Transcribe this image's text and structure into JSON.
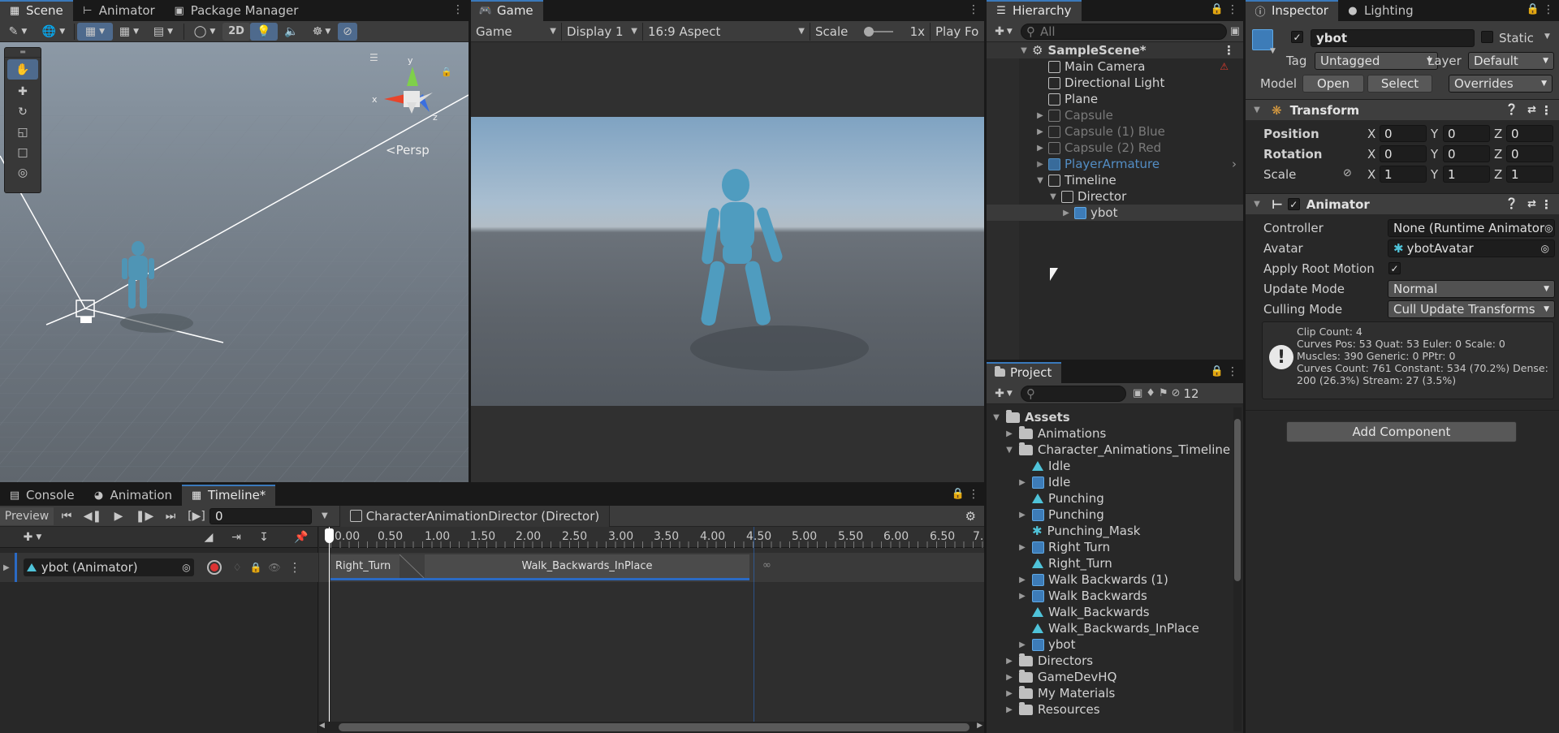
{
  "scene_panel": {
    "tabs": [
      {
        "label": "Scene"
      },
      {
        "label": "Animator"
      },
      {
        "label": "Package Manager"
      }
    ],
    "toolbar": {
      "mode_2d": "2D"
    },
    "gizmo": {
      "persp": "<Persp",
      "axis_x": "x",
      "axis_y": "y",
      "axis_z": "z"
    }
  },
  "game_panel": {
    "tab": "Game",
    "toolbar": {
      "view": "Game",
      "display": "Display 1",
      "aspect": "16:9 Aspect",
      "scale_label": "Scale",
      "scale_value": "1x",
      "play_focused": "Play Fo"
    }
  },
  "hierarchy": {
    "tab": "Hierarchy",
    "search_placeholder": "All",
    "scene_name": "SampleScene*",
    "items": [
      {
        "label": "Main Camera"
      },
      {
        "label": "Directional Light"
      },
      {
        "label": "Plane"
      },
      {
        "label": "Capsule"
      },
      {
        "label": "Capsule (1) Blue"
      },
      {
        "label": "Capsule (2) Red"
      },
      {
        "label": "PlayerArmature"
      },
      {
        "label": "Timeline"
      },
      {
        "label": "Director"
      },
      {
        "label": "ybot"
      }
    ]
  },
  "project": {
    "tab": "Project",
    "hidden_count": "12",
    "root": "Assets",
    "items": [
      {
        "label": "Animations"
      },
      {
        "label": "Character_Animations_Timeline"
      },
      {
        "label": "Idle"
      },
      {
        "label": "Idle"
      },
      {
        "label": "Punching"
      },
      {
        "label": "Punching"
      },
      {
        "label": "Punching_Mask"
      },
      {
        "label": "Right Turn"
      },
      {
        "label": "Right_Turn"
      },
      {
        "label": "Walk Backwards (1)"
      },
      {
        "label": "Walk Backwards"
      },
      {
        "label": "Walk_Backwards"
      },
      {
        "label": "Walk_Backwards_InPlace"
      },
      {
        "label": "ybot"
      },
      {
        "label": "Directors"
      },
      {
        "label": "GameDevHQ"
      },
      {
        "label": "My Materials"
      },
      {
        "label": "Resources"
      }
    ]
  },
  "inspector": {
    "tabs": [
      {
        "label": "Inspector"
      },
      {
        "label": "Lighting"
      }
    ],
    "object_name": "ybot",
    "static_label": "Static",
    "tag_label": "Tag",
    "tag_value": "Untagged",
    "layer_label": "Layer",
    "layer_value": "Default",
    "model_label": "Model",
    "open_label": "Open",
    "select_label": "Select",
    "overrides_label": "Overrides",
    "transform": {
      "title": "Transform",
      "position_label": "Position",
      "rotation_label": "Rotation",
      "scale_label": "Scale",
      "axis_x": "X",
      "axis_y": "Y",
      "axis_z": "Z",
      "position": {
        "x": "0",
        "y": "0",
        "z": "0"
      },
      "rotation": {
        "x": "0",
        "y": "0",
        "z": "0"
      },
      "scale": {
        "x": "1",
        "y": "1",
        "z": "1"
      }
    },
    "animator": {
      "title": "Animator",
      "controller_label": "Controller",
      "controller_value": "None (Runtime Animator",
      "avatar_label": "Avatar",
      "avatar_value": "ybotAvatar",
      "apply_root_motion_label": "Apply Root Motion",
      "update_mode_label": "Update Mode",
      "update_mode_value": "Normal",
      "culling_mode_label": "Culling Mode",
      "culling_mode_value": "Cull Update Transforms",
      "info_line1": "Clip Count: 4",
      "info_line2": "Curves Pos: 53 Quat: 53 Euler: 0 Scale: 0",
      "info_line3": "Muscles: 390 Generic: 0 PPtr: 0",
      "info_line4": "Curves Count: 761 Constant: 534 (70.2%) Dense:",
      "info_line5": "200 (26.3%) Stream: 27 (3.5%)"
    },
    "add_component": "Add Component"
  },
  "timeline": {
    "tabs": [
      {
        "label": "Console"
      },
      {
        "label": "Animation"
      },
      {
        "label": "Timeline*"
      }
    ],
    "preview_label": "Preview",
    "frame_value": "0",
    "director_label": "CharacterAnimationDirector (Director)",
    "track_label": "ybot (Animator)",
    "ticks": [
      "0.00",
      "0.50",
      "1.00",
      "1.50",
      "2.00",
      "2.50",
      "3.00",
      "3.50",
      "4.00",
      "4.50",
      "5.00",
      "5.50",
      "6.00",
      "6.50",
      "7."
    ],
    "clips": [
      {
        "label": "Right_Turn"
      },
      {
        "label": "Walk_Backwards_InPlace"
      }
    ]
  }
}
